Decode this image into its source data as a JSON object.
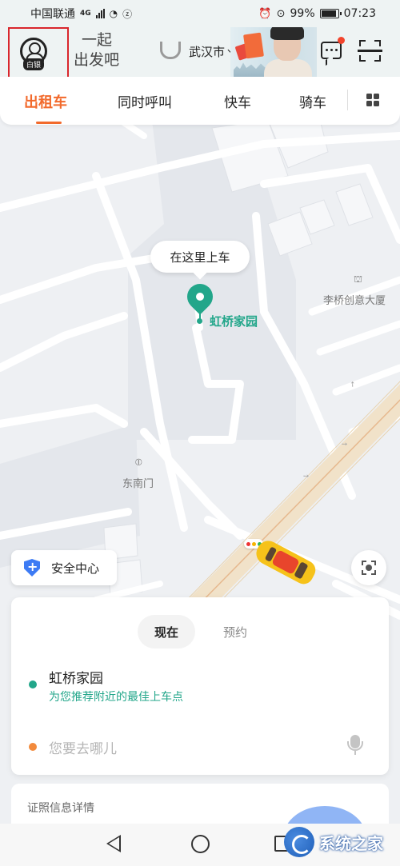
{
  "status_bar": {
    "carrier": "中国联通",
    "network": "4G",
    "battery": "99%",
    "time": "07:23"
  },
  "header": {
    "badge": "白银",
    "slogan_line1": "一起",
    "slogan_line2": "出发吧",
    "city": "武汉市"
  },
  "tabs": [
    {
      "label": "出租车",
      "active": true
    },
    {
      "label": "同时呼叫",
      "active": false
    },
    {
      "label": "快车",
      "active": false
    },
    {
      "label": "骑车",
      "active": false
    }
  ],
  "map": {
    "pickup_bubble": "在这里上车",
    "pin_label": "虹桥家园",
    "poi_building": "李桥创意大厦",
    "poi_gate": "东南门",
    "safety_center": "安全中心"
  },
  "booking": {
    "mode_now": "现在",
    "mode_later": "预约",
    "from_name": "虹桥家园",
    "from_hint": "为您推荐附近的最佳上车点",
    "to_placeholder": "您要去哪儿"
  },
  "info_card": {
    "title": "证照信息详情"
  },
  "watermark": {
    "text": "系统之家"
  },
  "colors": {
    "accent": "#f26a2c",
    "green": "#22a68a",
    "dest": "#f28a3c",
    "shield": "#3d7bf4"
  }
}
